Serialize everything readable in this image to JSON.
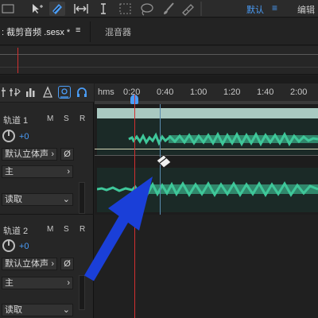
{
  "toolbar": {
    "tools": [
      "move-tool",
      "razor-tool",
      "slip-tool",
      "time-selection-tool",
      "marquee-tool",
      "lasso-tool",
      "brush-tool",
      "spot-healing-tool"
    ],
    "workspace_default": "默认",
    "workspace_edit": "编辑"
  },
  "tabs": {
    "editor": ": 裁剪音频 .sesx *",
    "close": "≡",
    "mixer": "混音器"
  },
  "ruler": {
    "units": "hms",
    "ticks": [
      "0:20",
      "0:40",
      "1:00",
      "1:20",
      "1:40",
      "2:00"
    ]
  },
  "tracks": [
    {
      "name": "轨道 1",
      "mute": "M",
      "solo": "S",
      "record": "R",
      "volume": "+0",
      "input": "默认立体声",
      "output": "主",
      "mode": "读取"
    },
    {
      "name": "轨道 2",
      "mute": "M",
      "solo": "S",
      "record": "R",
      "volume": "+0",
      "input": "默认立体声",
      "output": "主",
      "mode": "读取"
    }
  ],
  "colors": {
    "accent": "#4a9df8",
    "waveform": "#3fc79a",
    "clip_header": "#a9c9c1",
    "playhead": "#d23030",
    "arrow": "#1a3fd8"
  }
}
